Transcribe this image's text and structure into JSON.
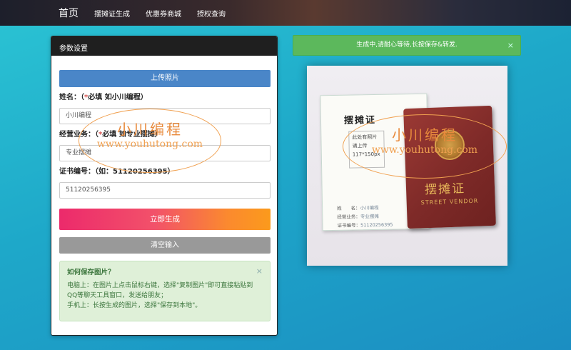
{
  "nav": {
    "brand": "首页",
    "links": [
      "摆摊证生成",
      "优惠券商城",
      "授权查询"
    ]
  },
  "panel": {
    "title": "参数设置",
    "upload_label": "上传照片",
    "fields": [
      {
        "label": "姓名：（",
        "req": "*",
        "hint": "必填 如小川编程）",
        "value": "小川编程"
      },
      {
        "label": "经营业务：（",
        "req": "*",
        "hint": "必填 如专业摆摊）",
        "value": "专业摆摊"
      },
      {
        "label": "证书编号：（如：51120256395）",
        "req": "",
        "hint": "",
        "value": "51120256395"
      }
    ],
    "generate_label": "立即生成",
    "clear_label": "清空输入"
  },
  "tips": {
    "title": "如何保存图片？",
    "close": "×",
    "pc": "电脑上：在图片上点击鼠标右键，选择\"复制图片\"即可直接粘贴到QQ等聊天工具窗口，发送给朋友；",
    "mobile": "手机上：长按生成的图片，选择\"保存到本地\"。"
  },
  "alert": {
    "text": "生成中,请耐心等待,长按保存&转发.",
    "close": "×"
  },
  "watermark": {
    "cn": "小川编程",
    "en": "www.youhutong.com"
  },
  "certificate": {
    "title": "摆摊证",
    "photo_lines": [
      "此处有照片",
      "请上传",
      "117*150px"
    ],
    "info_lines": [
      {
        "label": "姓　　名：",
        "value": "小川编程"
      },
      {
        "label": "经营业务：",
        "value": "专业摆摊"
      },
      {
        "label": "证书编号：",
        "value": "51120256395"
      }
    ],
    "passport_title": "摆摊证",
    "passport_en": "STREET VENDOR"
  },
  "colors": {
    "nav_bg": "#1d1f2b",
    "upload_btn": "#4a86c8",
    "generate_gradient": [
      "#ec2a6b",
      "#fb9a1c"
    ],
    "clear_btn": "#999999",
    "alert_bg": "#5cb85c",
    "tips_bg": "#dff0d8",
    "passport": "#8b302c"
  }
}
